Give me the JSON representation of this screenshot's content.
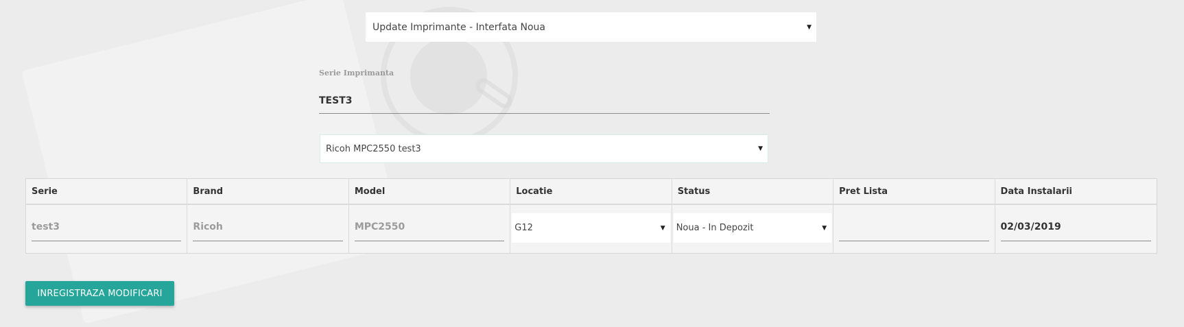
{
  "update_select": {
    "selected": "Update Imprimante - Interfata Noua"
  },
  "serie_field": {
    "label": "Serie Imprimanta",
    "value": "TEST3"
  },
  "printer_select": {
    "selected": "Ricoh MPC2550 test3"
  },
  "table": {
    "headers": [
      "Serie",
      "Brand",
      "Model",
      "Locatie",
      "Status",
      "Pret Lista",
      "Data Instalarii"
    ],
    "row": {
      "serie": "test3",
      "brand": "Ricoh",
      "model": "MPC2550",
      "locatie": "G12",
      "status": "Noua - In Depozit",
      "pret_lista": "",
      "data_instalarii": "02/03/2019"
    }
  },
  "buttons": {
    "save_label": "INREGISTRAZA MODIFICARI"
  },
  "colors": {
    "accent": "#26a69a",
    "background": "#ececec"
  },
  "icons": {
    "caret": "caret-down-icon"
  }
}
